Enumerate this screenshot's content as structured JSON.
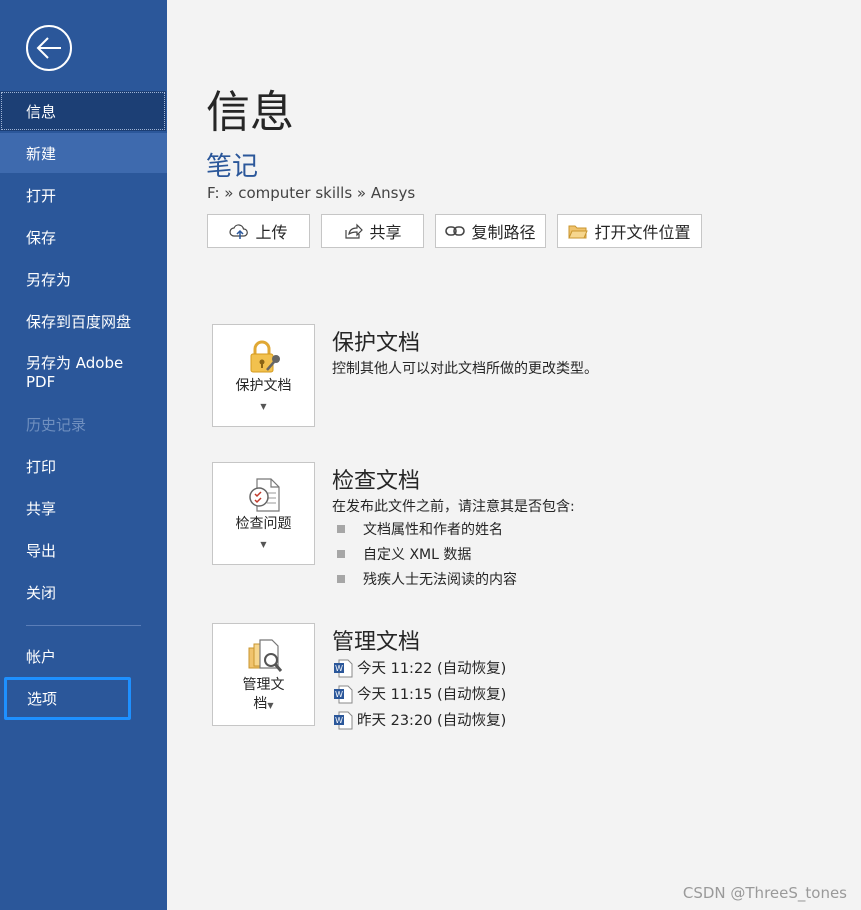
{
  "sidebar": {
    "items": [
      {
        "label": "信息"
      },
      {
        "label": "新建"
      },
      {
        "label": "打开"
      },
      {
        "label": "保存"
      },
      {
        "label": "另存为"
      },
      {
        "label": "保存到百度网盘"
      },
      {
        "label": "另存为 Adobe PDF"
      },
      {
        "label": "历史记录"
      },
      {
        "label": "打印"
      },
      {
        "label": "共享"
      },
      {
        "label": "导出"
      },
      {
        "label": "关闭"
      },
      {
        "label": "帐户"
      },
      {
        "label": "选项"
      }
    ]
  },
  "main": {
    "title": "信息",
    "doc_name": "笔记",
    "breadcrumb": "F: » computer skills » Ansys",
    "actions": [
      {
        "label": "上传",
        "icon": "cloud-upload-icon"
      },
      {
        "label": "共享",
        "icon": "share-icon"
      },
      {
        "label": "复制路径",
        "icon": "link-icon"
      },
      {
        "label": "打开文件位置",
        "icon": "folder-icon"
      }
    ]
  },
  "protect": {
    "tile_label": "保护文档",
    "title": "保护文档",
    "desc": "控制其他人可以对此文档所做的更改类型。"
  },
  "inspect": {
    "tile_label": "检查问题",
    "title": "检查文档",
    "desc": "在发布此文件之前，请注意其是否包含:",
    "bullets": [
      "文档属性和作者的姓名",
      "自定义 XML 数据",
      "残疾人士无法阅读的内容"
    ]
  },
  "manage": {
    "tile_label_line1": "管理文",
    "tile_label_line2": "档",
    "title": "管理文档",
    "versions": [
      "今天 11:22 (自动恢复)",
      "今天 11:15 (自动恢复)",
      "昨天 23:20 (自动恢复)"
    ]
  },
  "watermark": "CSDN @ThreeS_tones",
  "colors": {
    "sidebar_bg": "#2b579a",
    "selected_bg": "#1c3f75",
    "highlight_border": "#1e90ff",
    "doc_name": "#2b579a"
  }
}
